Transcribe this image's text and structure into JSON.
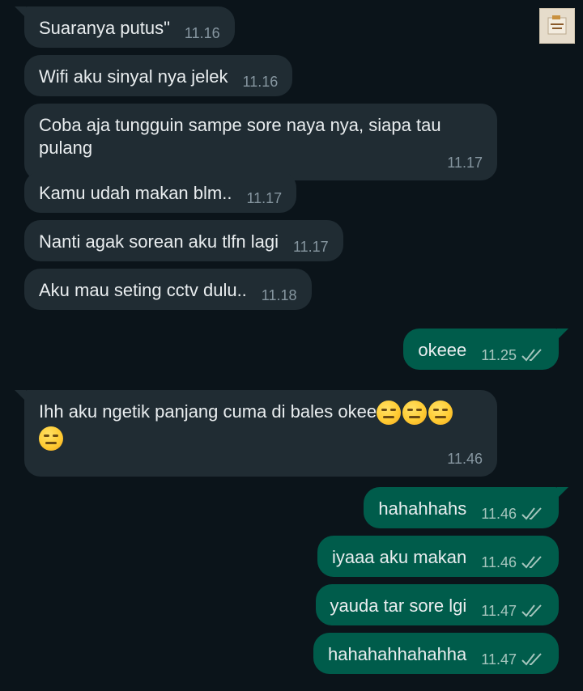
{
  "chat": {
    "messages": [
      {
        "direction": "in",
        "text": "Suaranya putus\"",
        "time": "11.16"
      },
      {
        "direction": "in",
        "text": "Wifi aku sinyal nya jelek",
        "time": "11.16"
      },
      {
        "direction": "in",
        "text_line1": "Coba aja tungguin sampe sore naya nya, siapa tau",
        "text_line2": "pulang",
        "time": "11.17"
      },
      {
        "direction": "in",
        "text": "Kamu udah makan blm..",
        "time": "11.17"
      },
      {
        "direction": "in",
        "text": "Nanti agak sorean aku tlfn lagi",
        "time": "11.17"
      },
      {
        "direction": "in",
        "text": "Aku mau seting cctv dulu..",
        "time": "11.18"
      },
      {
        "direction": "out",
        "text": "okeee",
        "time": "11.25",
        "status": "read"
      },
      {
        "direction": "in",
        "text": "Ihh aku ngetik panjang cuma di bales okee",
        "emoji": "expressionless-face",
        "emoji_count": 4,
        "time": "11.46"
      },
      {
        "direction": "out",
        "text": "hahahhahs",
        "time": "11.46",
        "status": "read"
      },
      {
        "direction": "out",
        "text": "iyaaa aku makan",
        "time": "11.46",
        "status": "read"
      },
      {
        "direction": "out",
        "text": "yauda tar sore lgi",
        "time": "11.47",
        "status": "read"
      },
      {
        "direction": "out",
        "text": "hahahahhahahha",
        "time": "11.47",
        "status": "read"
      }
    ]
  },
  "colors": {
    "background": "#0b141a",
    "incoming_bubble": "#202c33",
    "outgoing_bubble": "#005c4b",
    "message_text": "#e9edef",
    "timestamp": "#8696a0",
    "read_ticks": "#a5c5bd"
  },
  "icons": {
    "read_receipt": "double-check-icon",
    "emoji": "expressionless-face-emoji",
    "sticker": "sticker-thumbnail"
  }
}
